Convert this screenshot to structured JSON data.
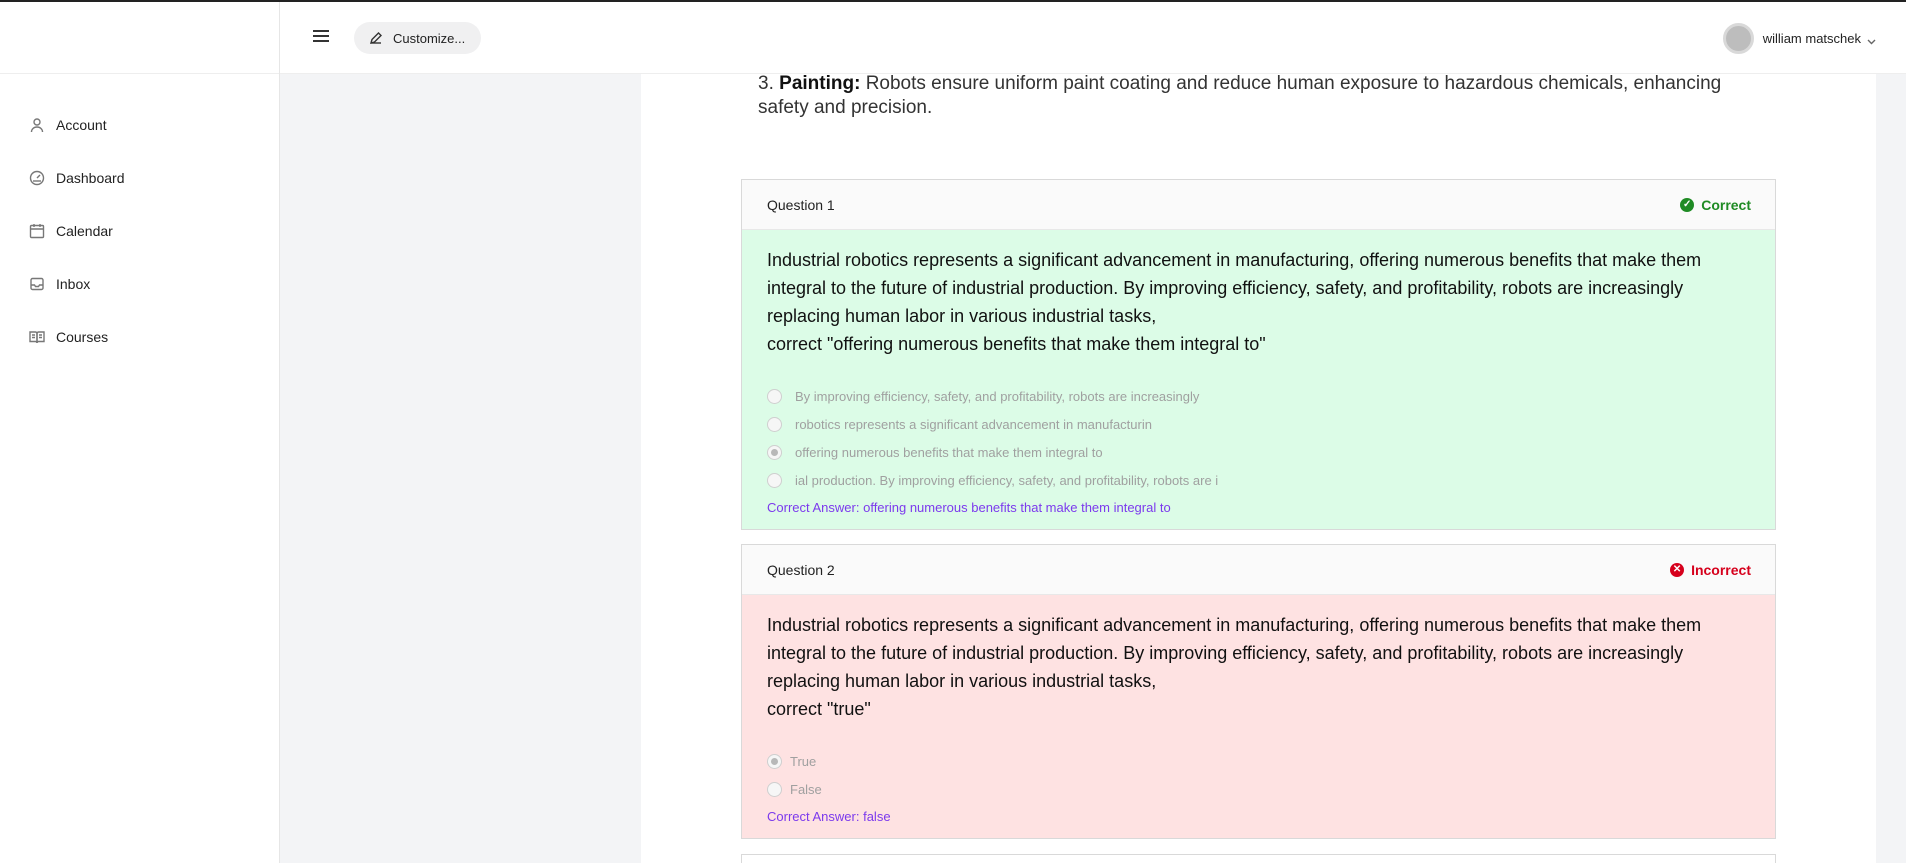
{
  "user": {
    "name": "william matschek"
  },
  "header": {
    "customize_label": "Customize..."
  },
  "sidebar": {
    "items": [
      {
        "label": "Account",
        "icon": "user-icon"
      },
      {
        "label": "Dashboard",
        "icon": "gauge-icon"
      },
      {
        "label": "Calendar",
        "icon": "calendar-icon"
      },
      {
        "label": "Inbox",
        "icon": "inbox-icon"
      },
      {
        "label": "Courses",
        "icon": "book-icon"
      }
    ]
  },
  "intro": {
    "number": "3.",
    "bold": "Painting:",
    "text": " Robots ensure uniform paint coating and reduce human exposure to hazardous chemicals, enhancing safety and precision."
  },
  "questions": [
    {
      "title": "Question 1",
      "status": "Correct",
      "text": "Industrial robotics represents a significant advancement in manufacturing, offering numerous benefits that make them integral to the future of industrial production. By improving efficiency, safety, and profitability, robots are increasingly replacing human labor in various industrial tasks,",
      "prompt": "correct \"offering numerous benefits that make them integral to\"",
      "options": [
        "By improving efficiency, safety, and profitability, robots are increasingly",
        "robotics represents a significant advancement in manufacturin",
        "offering numerous benefits that make them integral to",
        "ial production. By improving efficiency, safety, and profitability, robots are i"
      ],
      "selected_option": "offering numerous benefits that make them integral to",
      "answer": "Correct Answer: offering numerous benefits that make them integral to"
    },
    {
      "title": "Question 2",
      "status": "Incorrect",
      "text": "Industrial robotics represents a significant advancement in manufacturing, offering numerous benefits that make them integral to the future of industrial production. By improving efficiency, safety, and profitability, robots are increasingly replacing human labor in various industrial tasks,",
      "prompt": "correct \"true\"",
      "options": [
        "True",
        "False"
      ],
      "selected_option": "True",
      "answer": "Correct Answer: false"
    }
  ],
  "colors": {
    "correct_bg": "#dcfce7",
    "incorrect_bg": "#fee2e2",
    "correct_text": "#1f8b24",
    "incorrect_text": "#d6001c",
    "answer_text": "#7c3aed"
  }
}
